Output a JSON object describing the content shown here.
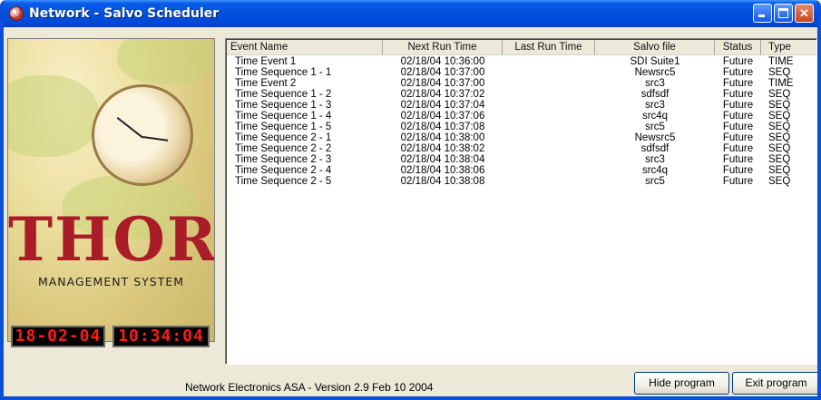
{
  "window": {
    "title": "Network - Salvo Scheduler"
  },
  "logo": {
    "brand": "THOR",
    "tagline": "MANAGEMENT SYSTEM"
  },
  "clock": {
    "date": "18-02-04",
    "time": "10:34:04"
  },
  "table": {
    "headers": [
      "Event Name",
      "Next Run Time",
      "Last Run Time",
      "Salvo file",
      "Status",
      "Type"
    ],
    "rows": [
      [
        "Time Event 1",
        "02/18/04 10:36:00",
        "",
        "SDI Suite1",
        "Future",
        "TIME"
      ],
      [
        "Time Sequence 1 - 1",
        "02/18/04 10:37:00",
        "",
        "Newsrc5",
        "Future",
        "SEQ"
      ],
      [
        "Time Event 2",
        "02/18/04 10:37:00",
        "",
        "src3",
        "Future",
        "TIME"
      ],
      [
        "Time Sequence 1 - 2",
        "02/18/04 10:37:02",
        "",
        "sdfsdf",
        "Future",
        "SEQ"
      ],
      [
        "Time Sequence 1 - 3",
        "02/18/04 10:37:04",
        "",
        "src3",
        "Future",
        "SEQ"
      ],
      [
        "Time Sequence 1 - 4",
        "02/18/04 10:37:06",
        "",
        "src4q",
        "Future",
        "SEQ"
      ],
      [
        "Time Sequence 1 - 5",
        "02/18/04 10:37:08",
        "",
        "src5",
        "Future",
        "SEQ"
      ],
      [
        "Time Sequence 2 - 1",
        "02/18/04 10:38:00",
        "",
        "Newsrc5",
        "Future",
        "SEQ"
      ],
      [
        "Time Sequence 2 - 2",
        "02/18/04 10:38:02",
        "",
        "sdfsdf",
        "Future",
        "SEQ"
      ],
      [
        "Time Sequence 2 - 3",
        "02/18/04 10:38:04",
        "",
        "src3",
        "Future",
        "SEQ"
      ],
      [
        "Time Sequence 2 - 4",
        "02/18/04 10:38:06",
        "",
        "src4q",
        "Future",
        "SEQ"
      ],
      [
        "Time Sequence 2 - 5",
        "02/18/04 10:38:08",
        "",
        "src5",
        "Future",
        "SEQ"
      ]
    ]
  },
  "footer": {
    "version_text": "Network Electronics ASA - Version 2.9 Feb 10 2004",
    "hide_label": "Hide program",
    "exit_label": "Exit program"
  }
}
